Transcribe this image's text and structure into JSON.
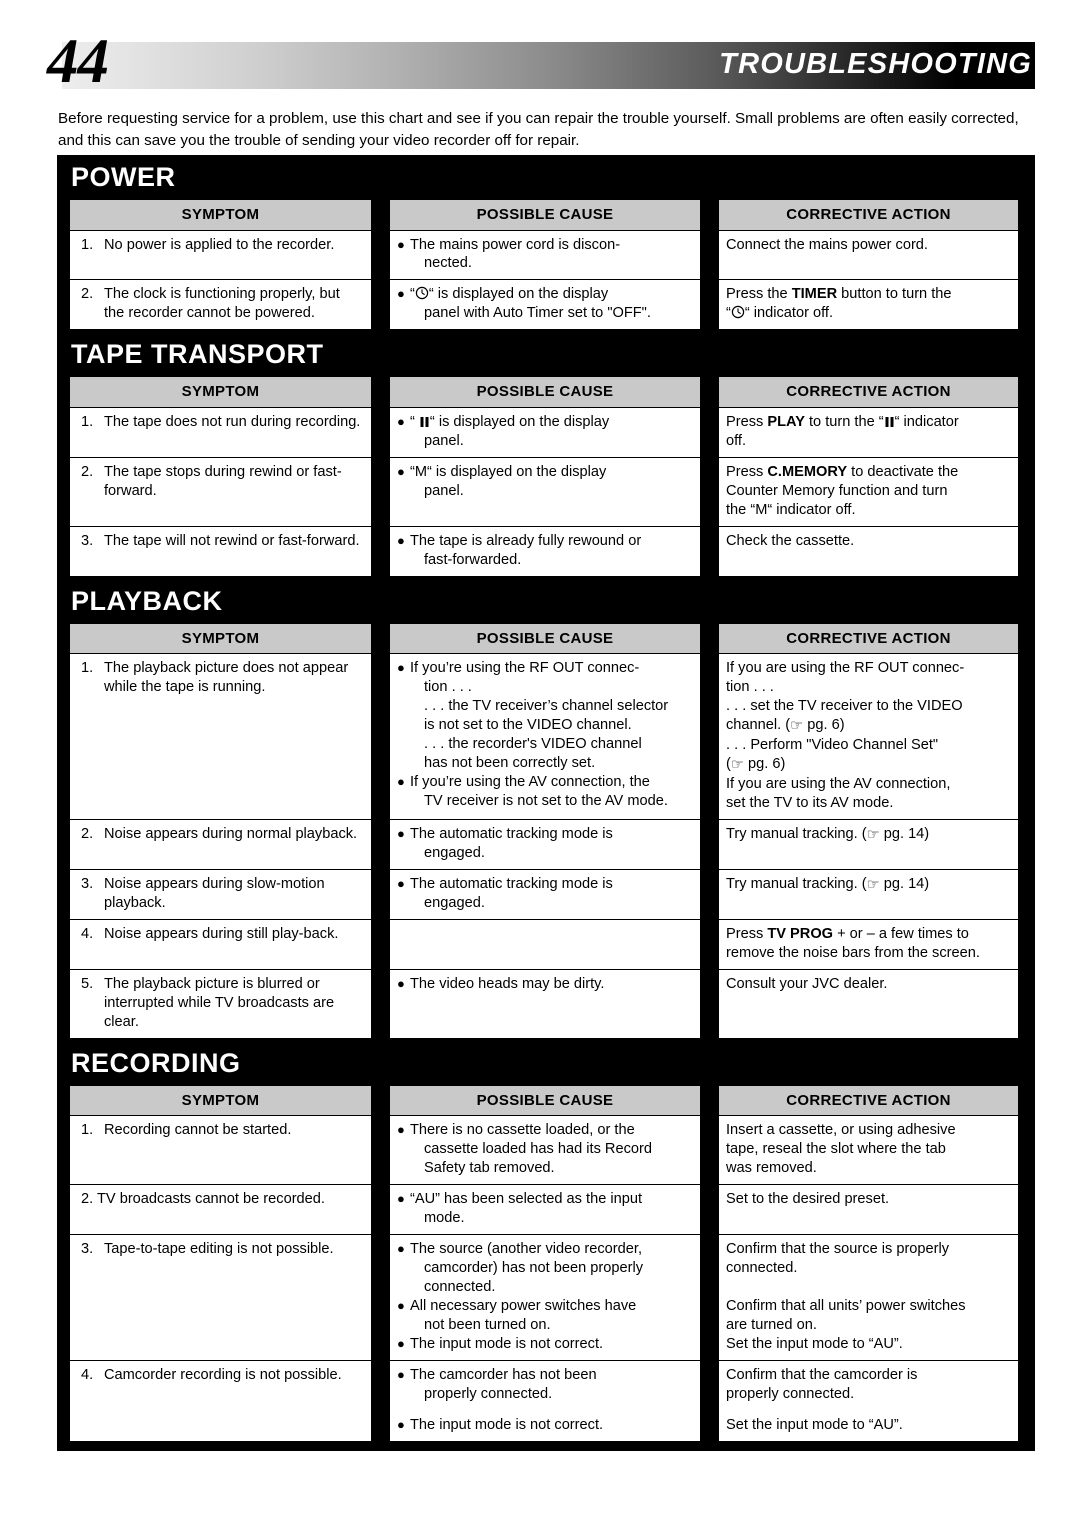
{
  "header": {
    "page_number": "44",
    "title": "TROUBLESHOOTING"
  },
  "intro": "Before requesting service for a problem, use this chart and see if you can repair the trouble yourself. Small problems are often easily corrected, and this can save you the trouble of sending your video recorder off for repair.",
  "columns": {
    "symptom": "SYMPTOM",
    "possible_cause": "POSSIBLE CAUSE",
    "corrective_action": "CORRECTIVE ACTION"
  },
  "icons": {
    "clock": "clock-indicator-icon",
    "pause": "pause-indicator-icon",
    "hand": "pointing-hand-icon",
    "bullet": "bullet-dot-icon"
  },
  "sections": {
    "power": {
      "title": "POWER",
      "rows": [
        {
          "num": "1.",
          "symptom": "No power is applied to the recorder.",
          "cause_1": "The mains power cord is discon-",
          "cause_2": "nected.",
          "action": "Connect the mains power cord."
        },
        {
          "num": "2.",
          "symptom": "The clock is functioning properly, but the recorder cannot be powered.",
          "cause_pre": "“",
          "cause_post": "“  is displayed on the display",
          "cause_2": "panel with Auto Timer set to \"OFF\".",
          "action_pre": "Press the ",
          "action_bold": "TIMER",
          "action_post": " button to turn the",
          "action_2_pre": "“",
          "action_2_post": "“  indicator off."
        }
      ]
    },
    "tape_transport": {
      "title": "TAPE TRANSPORT",
      "rows": [
        {
          "num": "1.",
          "symptom": "The tape does not run during recording.",
          "cause_pre": "“ ",
          "cause_post": "“ is displayed on the display",
          "cause_2": "panel.",
          "action_pre": "Press ",
          "action_bold": "PLAY",
          "action_mid": " to turn the “",
          "action_post": "“ indicator",
          "action_2": "off."
        },
        {
          "num": "2.",
          "symptom": "The tape stops during rewind or fast-forward.",
          "cause_1": "“M“ is displayed on the display",
          "cause_2": "panel.",
          "action_pre": "Press ",
          "action_bold": "C.MEMORY",
          "action_post": " to deactivate the",
          "action_2": "Counter Memory function and turn",
          "action_3": "the “M“ indicator off."
        },
        {
          "num": "3.",
          "symptom": "The tape will not rewind or fast-forward.",
          "cause_1": "The tape is already fully rewound or",
          "cause_2": "fast-forwarded.",
          "action": "Check the cassette."
        }
      ]
    },
    "playback": {
      "title": "PLAYBACK",
      "rows": [
        {
          "num": "1.",
          "symptom": "The playback picture does not appear while the tape is running.",
          "cause_b1_l1": "If you’re using the RF OUT connec-",
          "cause_b1_l2": "tion . . .",
          "cause_b1_l3": ". . . the TV receiver’s channel selector",
          "cause_b1_l4": "is not set to the VIDEO channel.",
          "cause_b1_l5": ". . . the recorder's VIDEO channel",
          "cause_b1_l6": "has not been correctly set.",
          "cause_b2_l1": "If you’re using the AV connection, the",
          "cause_b2_l2": "TV receiver is not set to the AV mode.",
          "action_l1": "If you are using the RF OUT connec-",
          "action_l2": "tion . . .",
          "action_l3": ". . . set the TV receiver to the VIDEO",
          "action_l4_pre": "channel. (",
          "action_l4_post": " pg. 6)",
          "action_l5": ". . . Perform \"Video Channel Set\"",
          "action_l6_pre": "(",
          "action_l6_post": " pg. 6)",
          "action_l7": "If you are using the AV connection,",
          "action_l8": "set the TV to its AV mode."
        },
        {
          "num": "2.",
          "symptom": "Noise appears during normal playback.",
          "cause_1": "The automatic tracking mode is",
          "cause_2": "engaged.",
          "action_pre": "Try manual tracking. (",
          "action_post": " pg. 14)"
        },
        {
          "num": "3.",
          "symptom": "Noise appears during slow-motion playback.",
          "cause_1": "The automatic tracking mode is",
          "cause_2": "engaged.",
          "action_pre": "Try manual tracking. (",
          "action_post": " pg. 14)"
        },
        {
          "num": "4.",
          "symptom": "Noise appears during still play-back.",
          "cause_1": "",
          "cause_2": "",
          "action_pre": "Press ",
          "action_bold": "TV PROG",
          "action_post": " + or – a few times to",
          "action_2": "remove the noise bars from the screen."
        },
        {
          "num": "5.",
          "symptom": "The playback picture is blurred or interrupted while TV broadcasts are clear.",
          "cause_1": "The video heads may be dirty.",
          "action": "Consult your JVC dealer."
        }
      ]
    },
    "recording": {
      "title": "RECORDING",
      "rows": [
        {
          "num": "1.",
          "symptom": "Recording cannot be started.",
          "cause_1": "There is no cassette loaded, or the",
          "cause_2": "cassette loaded has had its Record",
          "cause_3": "Safety tab removed.",
          "action_l1": "Insert a cassette, or using adhesive",
          "action_l2": "tape, reseal the slot where the tab",
          "action_l3": "was removed."
        },
        {
          "num": "2.",
          "symptom": "TV broadcasts cannot be recorded.",
          "cause_1": "“AU” has been selected as the input",
          "cause_2": "mode.",
          "action_l1": "Set to the desired preset."
        },
        {
          "num": "3.",
          "symptom": "Tape-to-tape editing is not possible.",
          "cause_b1_l1": "The source (another video recorder,",
          "cause_b1_l2": "camcorder) has not been properly",
          "cause_b1_l3": "connected.",
          "cause_b2_l1": "All necessary power switches have",
          "cause_b2_l2": "not been turned on.",
          "cause_b3_l1": "The input mode is not correct.",
          "action_l1": "Confirm that the source is properly",
          "action_l2": "connected.",
          "action_l3": "Confirm that all units’ power switches",
          "action_l4": "are turned on.",
          "action_l5": "Set the input mode to “AU”."
        },
        {
          "num": "4.",
          "symptom": "Camcorder recording is not possible.",
          "cause_b1_l1": "The camcorder has not been",
          "cause_b1_l2": "properly connected.",
          "cause_b2_l1": "The input mode is not correct.",
          "action_l1": "Confirm that the camcorder is",
          "action_l2": "properly connected.",
          "action_l3": "Set the input mode to “AU”."
        }
      ]
    }
  }
}
